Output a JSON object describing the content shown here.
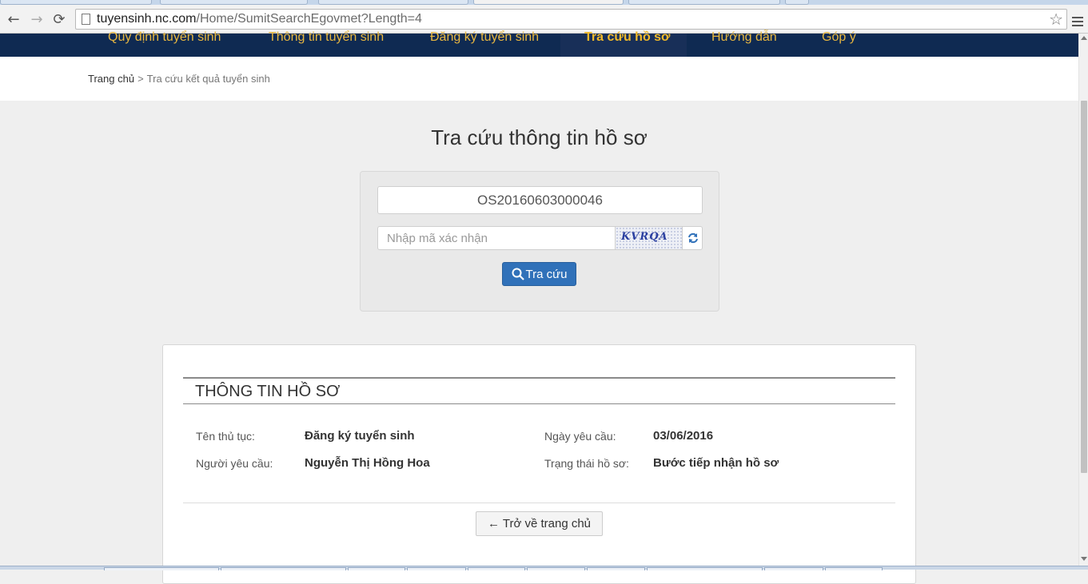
{
  "browser": {
    "url_host": "tuyensinh.nc.com",
    "url_path": "/Home/SumitSearchEgovmet?Length=4",
    "back_icon": "←",
    "forward_icon": "→",
    "reload_icon": "⟳",
    "star_icon": "☆"
  },
  "nav": {
    "items": [
      {
        "label": "Quy định tuyển sinh"
      },
      {
        "label": "Thông tin tuyển sinh"
      },
      {
        "label": "Đăng ký tuyển sinh"
      },
      {
        "label": "Tra cứu hồ sơ"
      },
      {
        "label": "Hướng dẫn"
      },
      {
        "label": "Góp ý"
      }
    ],
    "active_index": 3,
    "text_color": "#e8b740",
    "bg_color": "#0f2a52"
  },
  "breadcrumb": {
    "home": "Trang chủ",
    "separator": ">",
    "current": "Tra cứu kết quả tuyển sinh"
  },
  "search": {
    "title": "Tra cứu thông tin hồ sơ",
    "code_value": "OS20160603000046",
    "captcha_placeholder": "Nhập mã xác nhận",
    "captcha_text": "KVRQA",
    "submit_label": "Tra cứu",
    "accent": "#3071b9"
  },
  "result": {
    "heading": "THÔNG TIN HỒ SƠ",
    "procedure_label": "Tên thủ tục:",
    "procedure_value": "Đăng ký tuyển sinh",
    "date_label": "Ngày yêu cầu:",
    "date_value": "03/06/2016",
    "requester_label": "Người yêu cầu:",
    "requester_value": "Nguyễn Thị Hồng Hoa",
    "status_label": "Trạng thái hồ sơ:",
    "status_value": "Bước tiếp nhận hồ sơ",
    "back_label": "← Trở về trang chủ"
  }
}
